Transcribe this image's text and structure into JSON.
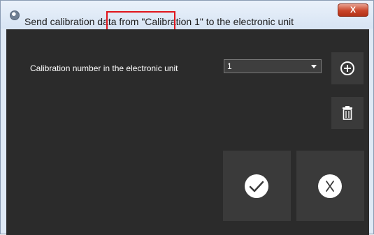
{
  "window": {
    "title": "Send calibration data from \"Calibration 1\" to the electronic unit",
    "close_label": "X"
  },
  "form": {
    "calibration_label": "Calibration number in the electronic unit",
    "calibration_value": "1"
  },
  "icons": {
    "app": "pce-logo-icon",
    "add": "plus-circle-icon",
    "delete": "trash-icon",
    "confirm": "check-circle-icon",
    "cancel": "x-circle-icon"
  },
  "colors": {
    "panel_background": "#2b2b2b",
    "tile_background": "#3a3a3a",
    "highlight_border": "#e0141b"
  }
}
